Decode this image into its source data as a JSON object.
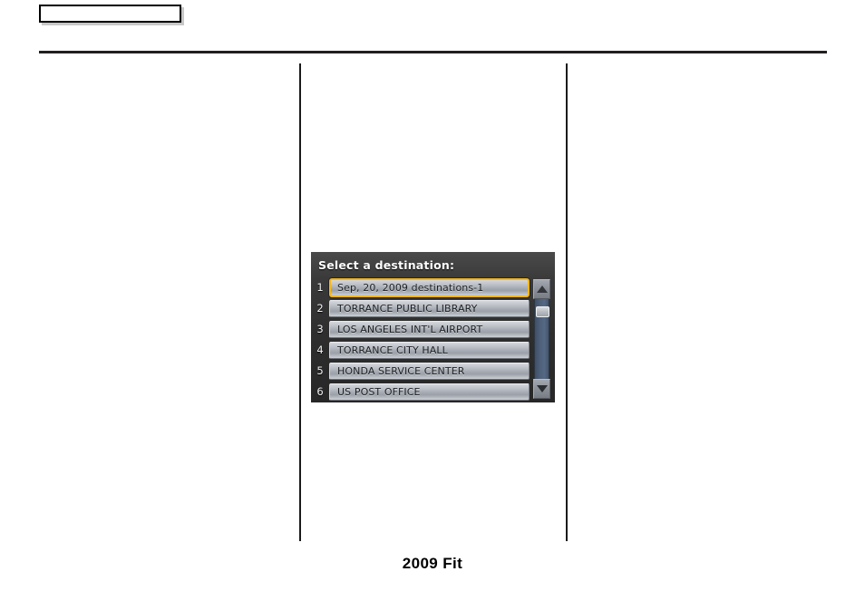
{
  "page": {
    "header_box_label": "",
    "footer_text": "2009  Fit"
  },
  "nav_screen": {
    "title": "Select a destination:",
    "selected_index": 1,
    "destinations": [
      {
        "number": "1",
        "label": "Sep, 20, 2009 destinations-1",
        "selected": true
      },
      {
        "number": "2",
        "label": "TORRANCE PUBLIC LIBRARY",
        "selected": false
      },
      {
        "number": "3",
        "label": "LOS ANGELES INT'L AIRPORT",
        "selected": false
      },
      {
        "number": "4",
        "label": "TORRANCE CITY HALL",
        "selected": false
      },
      {
        "number": "5",
        "label": "HONDA SERVICE CENTER",
        "selected": false
      },
      {
        "number": "6",
        "label": "US POST OFFICE",
        "selected": false
      }
    ],
    "scrollbar": {
      "up_icon": "triangle-up-icon",
      "down_icon": "triangle-down-icon"
    },
    "colors": {
      "selection_highlight": "#f5b61a",
      "screen_background": "#2e2e2e",
      "button_face": "#a9aeb6",
      "scroll_track": "#4d5f79"
    }
  }
}
